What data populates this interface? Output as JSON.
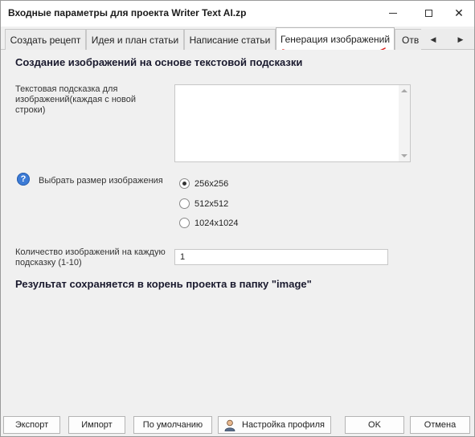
{
  "window": {
    "title": "Входные параметры для проекта Writer Text AI.zp"
  },
  "tabs": [
    {
      "label": "Создать рецепт",
      "active": false
    },
    {
      "label": "Идея и план статьи",
      "active": false
    },
    {
      "label": "Написание статьи",
      "active": false
    },
    {
      "label": "Генерация изображений",
      "active": true
    },
    {
      "label": "Отв",
      "active": false
    }
  ],
  "panel": {
    "heading": "Создание изображений на основе текстовой подсказки",
    "prompt_label": "Текстовая подсказка для изображений(каждая с новой строки)",
    "prompt_value": "",
    "size_label": "Выбрать размер изображения",
    "size_options": [
      {
        "label": "256x256",
        "checked": true
      },
      {
        "label": "512x512",
        "checked": false
      },
      {
        "label": "1024x1024",
        "checked": false
      }
    ],
    "count_label": "Количество изображений на каждую подсказку (1-10)",
    "count_value": "1",
    "result_note": "Результат сохраняется в корень проекта в папку \"image\""
  },
  "buttons": {
    "export": "Экспорт",
    "import": "Импорт",
    "defaults": "По умолчанию",
    "profile": "Настройка профиля",
    "ok": "OK",
    "cancel": "Отмена"
  },
  "colors": {
    "annotation_underline": "#e0201c",
    "help_icon": "#3c7bd6"
  }
}
